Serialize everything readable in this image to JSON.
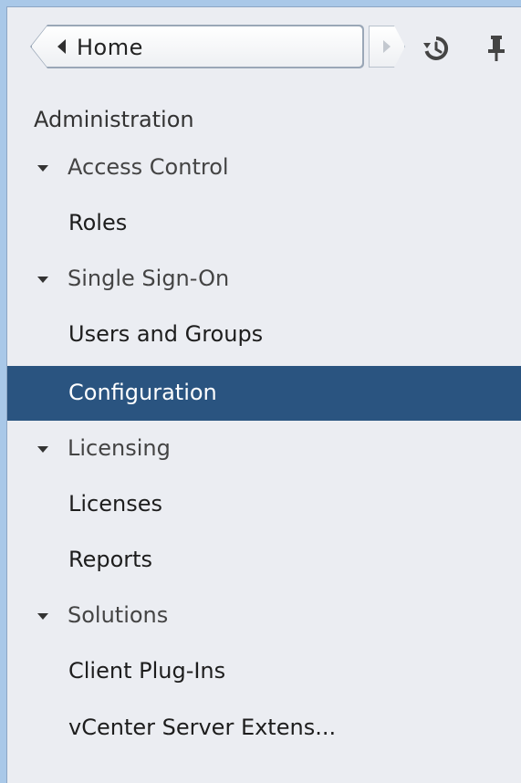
{
  "nav": {
    "home_label": "Home",
    "back_icon": "chevron-left-icon",
    "forward_icon": "chevron-right-icon",
    "history_icon": "history-icon",
    "pin_icon": "pin-icon"
  },
  "section": {
    "title": "Administration"
  },
  "groups": [
    {
      "label": "Access Control",
      "items": [
        "Roles"
      ]
    },
    {
      "label": "Single Sign-On",
      "items": [
        "Users and Groups",
        "Configuration"
      ]
    },
    {
      "label": "Licensing",
      "items": [
        "Licenses",
        "Reports"
      ]
    },
    {
      "label": "Solutions",
      "items": [
        "Client Plug-Ins",
        "vCenter Server Extens..."
      ]
    }
  ],
  "selected_item": "Configuration",
  "colors": {
    "selected_bg": "#2a5480",
    "panel_bg": "#ebedf2",
    "frame": "#a9c8e8"
  }
}
